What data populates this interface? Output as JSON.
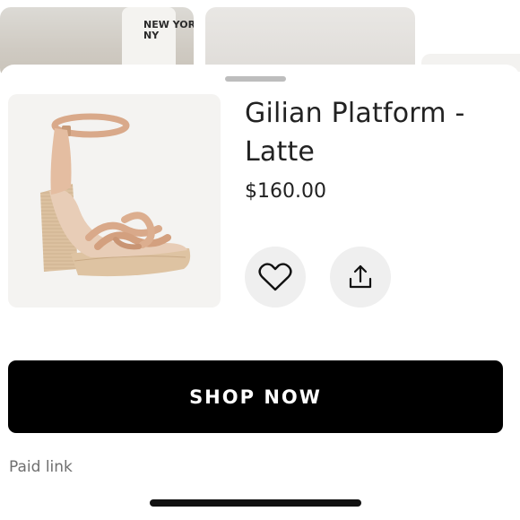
{
  "product": {
    "title": "Gilian Platform - Latte",
    "price": "$160.00",
    "image_icon": "sandal-product-image"
  },
  "actions": {
    "favorite_icon": "heart-icon",
    "share_icon": "share-icon"
  },
  "cta": {
    "label": "SHOP NOW"
  },
  "footer": {
    "disclosure": "Paid link"
  },
  "background_feed": {
    "tee_text": "NEW YOR\nNY"
  },
  "colors": {
    "cta_bg": "#000000",
    "cta_text": "#ffffff",
    "icon_button_bg": "#efefef",
    "product_tan": "#d9a98a"
  }
}
